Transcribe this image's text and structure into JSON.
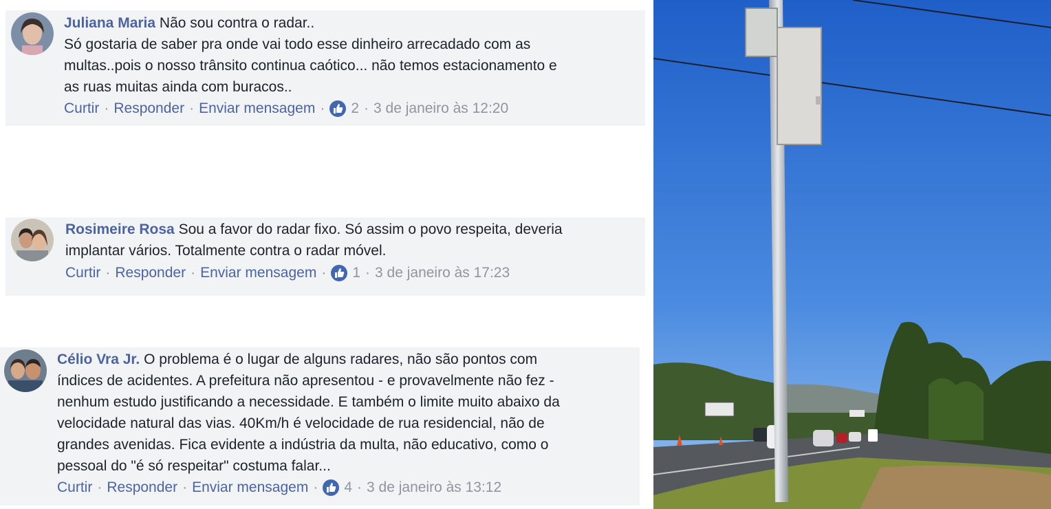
{
  "comments": [
    {
      "author": "Juliana Maria",
      "text_first": "Não sou contra o radar..",
      "text_rest": "Só gostaria de saber pra onde vai todo esse dinheiro arrecadado com as\nmultas..pois o nosso trânsito continua caótico... não temos estacionamento e\nas ruas muitas ainda com buracos..",
      "actions": {
        "like": "Curtir",
        "reply": "Responder",
        "message": "Enviar mensagem"
      },
      "reactions": "2",
      "timestamp": "3 de janeiro às 12:20"
    },
    {
      "author": "Rosimeire Rosa",
      "text_first": "Sou a favor do radar fixo. Só assim o povo respeita, deveria",
      "text_rest": "implantar vários. Totalmente contra o radar móvel.",
      "actions": {
        "like": "Curtir",
        "reply": "Responder",
        "message": "Enviar mensagem"
      },
      "reactions": "1",
      "timestamp": "3 de janeiro às 17:23"
    },
    {
      "author": "Célio Vra Jr.",
      "text_first": "O problema é o lugar de alguns radares, não são pontos com",
      "text_rest": "índices de acidentes. A prefeitura não apresentou - e provavelmente não fez -\nnenhum estudo justificando a necessidade. E também o limite muito abaixo da\nvelocidade natural das vias. 40Km/h é velocidade de rua residencial, não de\ngrandes avenidas. Fica evidente a indústria da multa, não educativo, como o\npessoal do \"é só respeitar\" costuma falar...",
      "actions": {
        "like": "Curtir",
        "reply": "Responder",
        "message": "Enviar mensagem"
      },
      "reactions": "4",
      "timestamp": "3 de janeiro às 13:12"
    }
  ],
  "separator": "·",
  "colors": {
    "link": "#4b64a1",
    "meta": "#90949c",
    "bubble": "#f2f3f5",
    "like": "#4267b2"
  },
  "icons": {
    "reaction": "thumbs-up-icon"
  }
}
